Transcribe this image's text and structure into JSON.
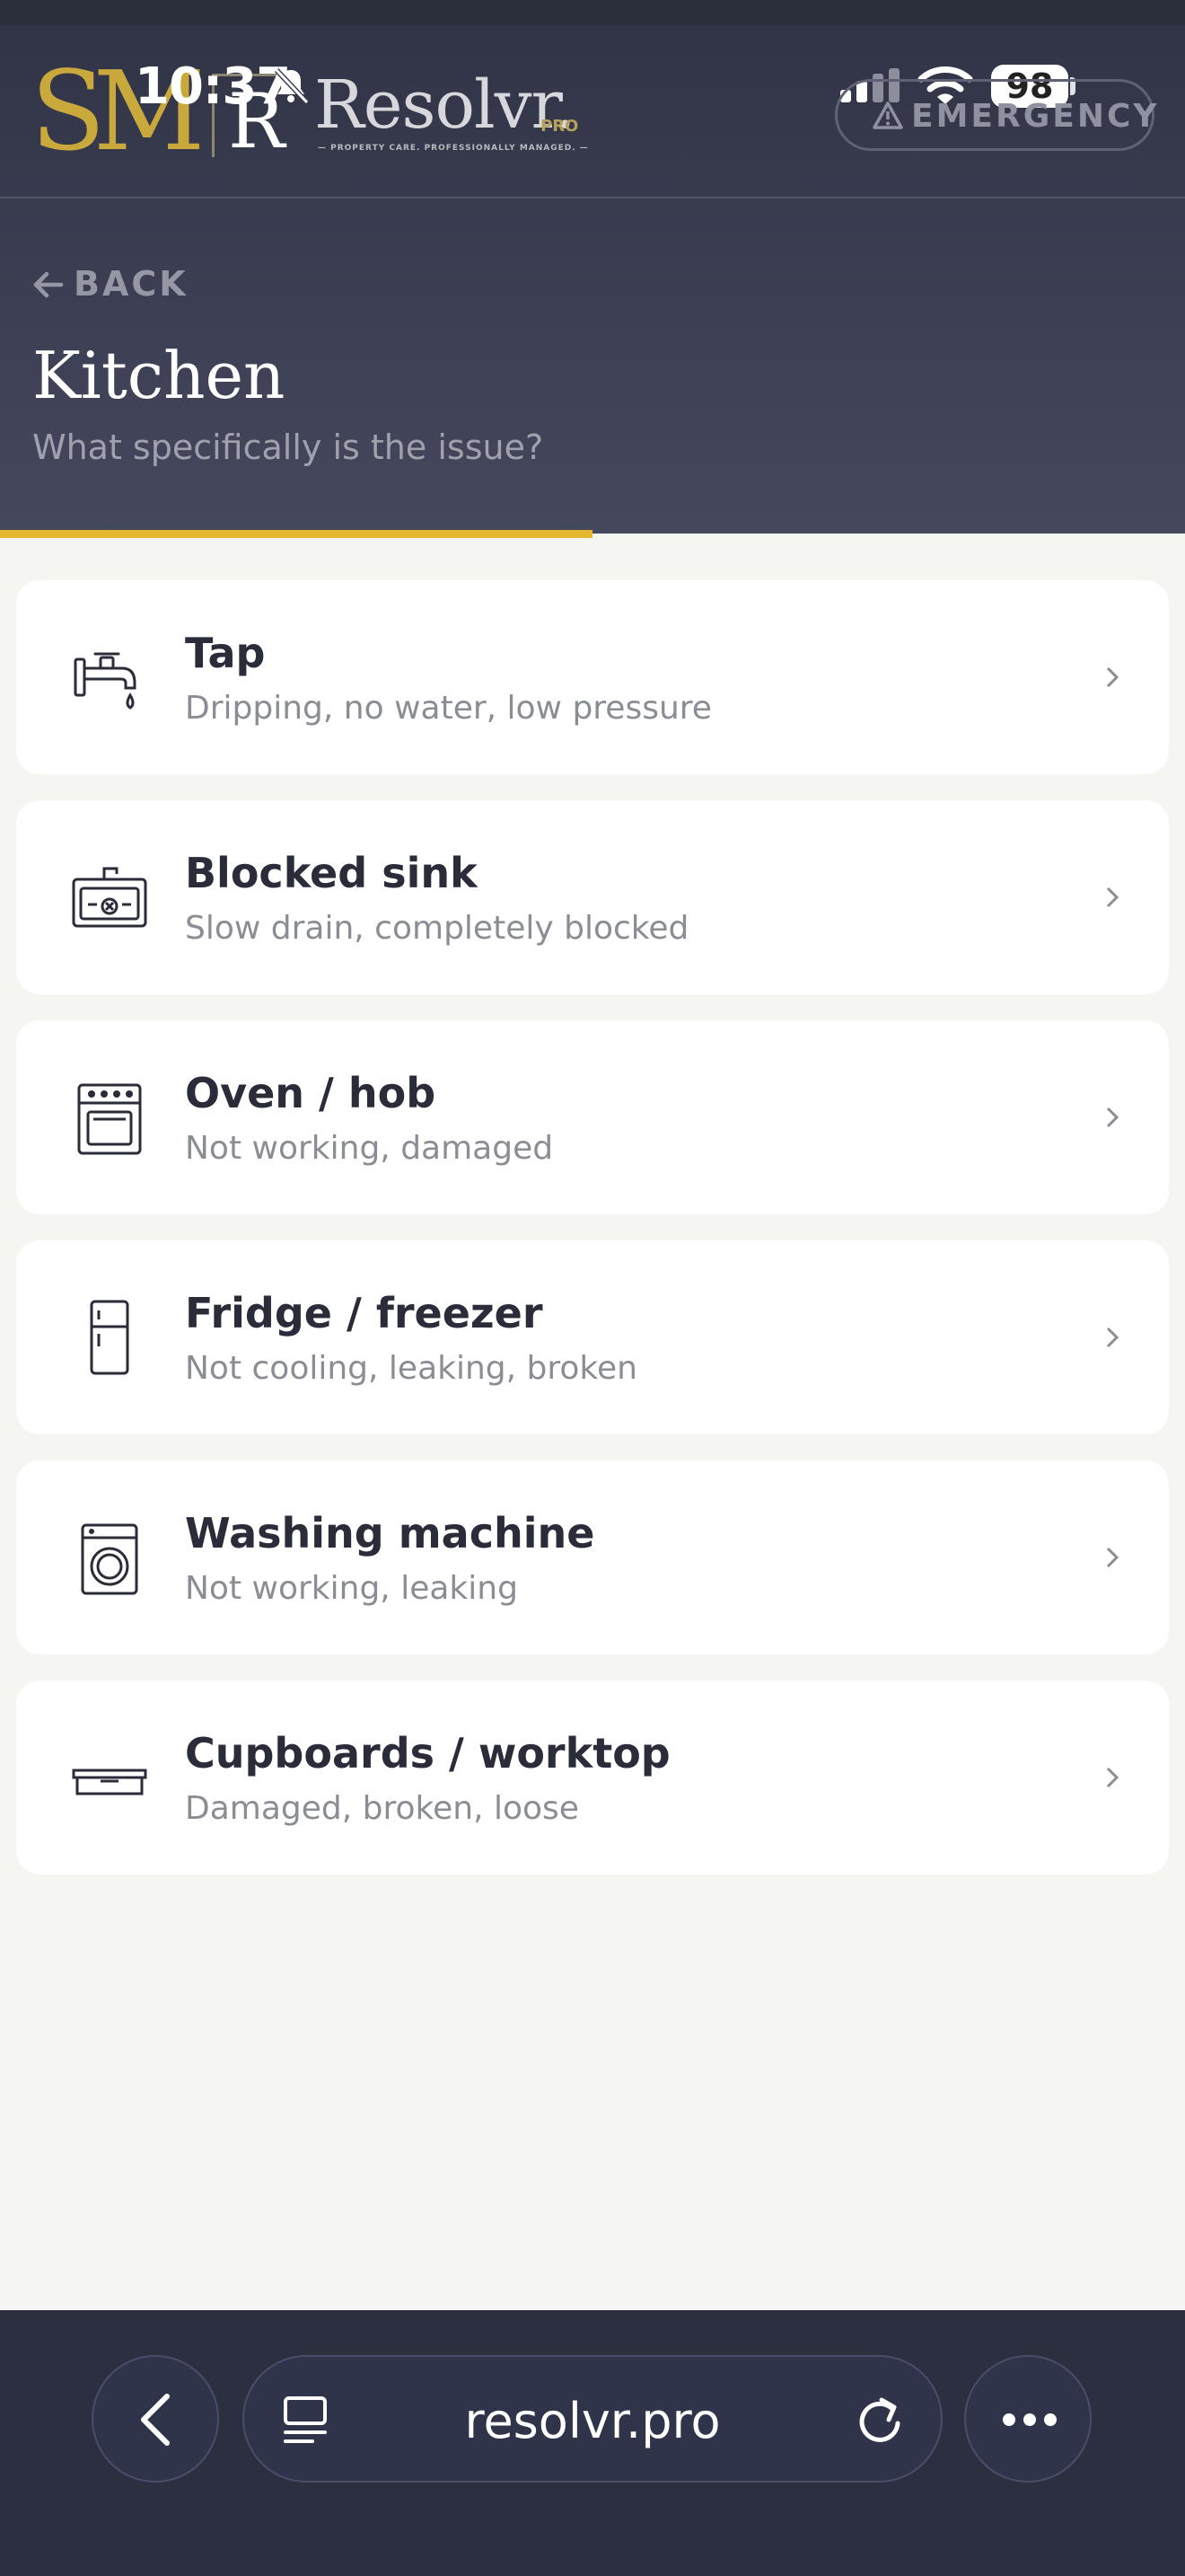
{
  "status_bar": {
    "time": "10:37",
    "battery": "98"
  },
  "brand": {
    "sm_logo": "SM",
    "r_mark": "R",
    "name": "Resolvr.",
    "suffix": "PRO",
    "tagline": "— PROPERTY CARE. PROFESSIONALLY MANAGED. —"
  },
  "header": {
    "emergency_label": "EMERGENCY",
    "back_label": "BACK",
    "title": "Kitchen",
    "subtitle": "What specifically is the issue?"
  },
  "progress": {
    "fraction": 0.5
  },
  "issues": [
    {
      "icon": "tap-icon",
      "title": "Tap",
      "description": "Dripping, no water, low pressure"
    },
    {
      "icon": "sink-icon",
      "title": "Blocked sink",
      "description": "Slow drain, completely blocked"
    },
    {
      "icon": "oven-icon",
      "title": "Oven / hob",
      "description": "Not working, damaged"
    },
    {
      "icon": "fridge-icon",
      "title": "Fridge / freezer",
      "description": "Not cooling, leaking, broken"
    },
    {
      "icon": "washing-machine-icon",
      "title": "Washing machine",
      "description": "Not working, leaking"
    },
    {
      "icon": "cupboard-icon",
      "title": "Cupboards / worktop",
      "description": "Damaged, broken, loose"
    }
  ],
  "browser": {
    "url": "resolvr.pro"
  },
  "colors": {
    "accent": "#e6b82f",
    "header_bg": "#3b3e52",
    "page_bg": "#f5f5f1",
    "logo_gold": "#c9a93c"
  }
}
